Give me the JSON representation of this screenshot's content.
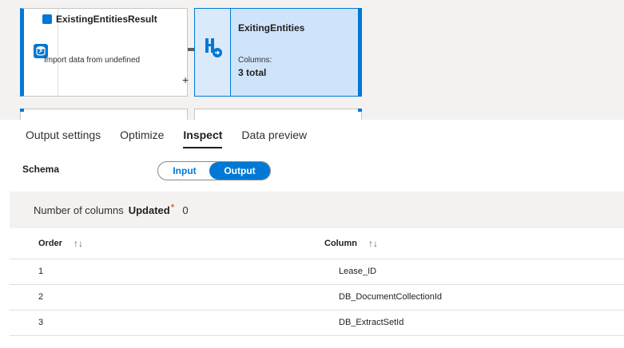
{
  "canvas": {
    "source_node": {
      "title": "ExistingEntitiesResult",
      "subtitle": "Import data from undefined"
    },
    "connector": {
      "add_symbol": "+"
    },
    "sink_node": {
      "title": "ExitingEntities",
      "columns_label": "Columns:",
      "columns_value": "3 total"
    }
  },
  "tabs": [
    {
      "label": "Output settings",
      "active": false
    },
    {
      "label": "Optimize",
      "active": false
    },
    {
      "label": "Inspect",
      "active": true
    },
    {
      "label": "Data preview",
      "active": false
    }
  ],
  "schema": {
    "label": "Schema",
    "toggle": {
      "input": "Input",
      "output": "Output",
      "selected": "Output"
    }
  },
  "column_count": {
    "label": "Number of columns",
    "updated_label": "Updated",
    "asterisk": "*",
    "value": "0"
  },
  "table": {
    "headers": {
      "order": "Order",
      "column": "Column",
      "sort_symbol": "↑↓"
    },
    "rows": [
      {
        "order": "1",
        "column": "Lease_ID"
      },
      {
        "order": "2",
        "column": "DB_DocumentCollectionId"
      },
      {
        "order": "3",
        "column": "DB_ExtractSetId"
      }
    ]
  },
  "colors": {
    "accent": "#0078d4",
    "sink_fill": "#cfe4fa",
    "band": "#f3f2f1",
    "asterisk": "#d83b01"
  },
  "icons": [
    "database-icon",
    "source-db-icon",
    "sink-icon",
    "sort-icon"
  ]
}
